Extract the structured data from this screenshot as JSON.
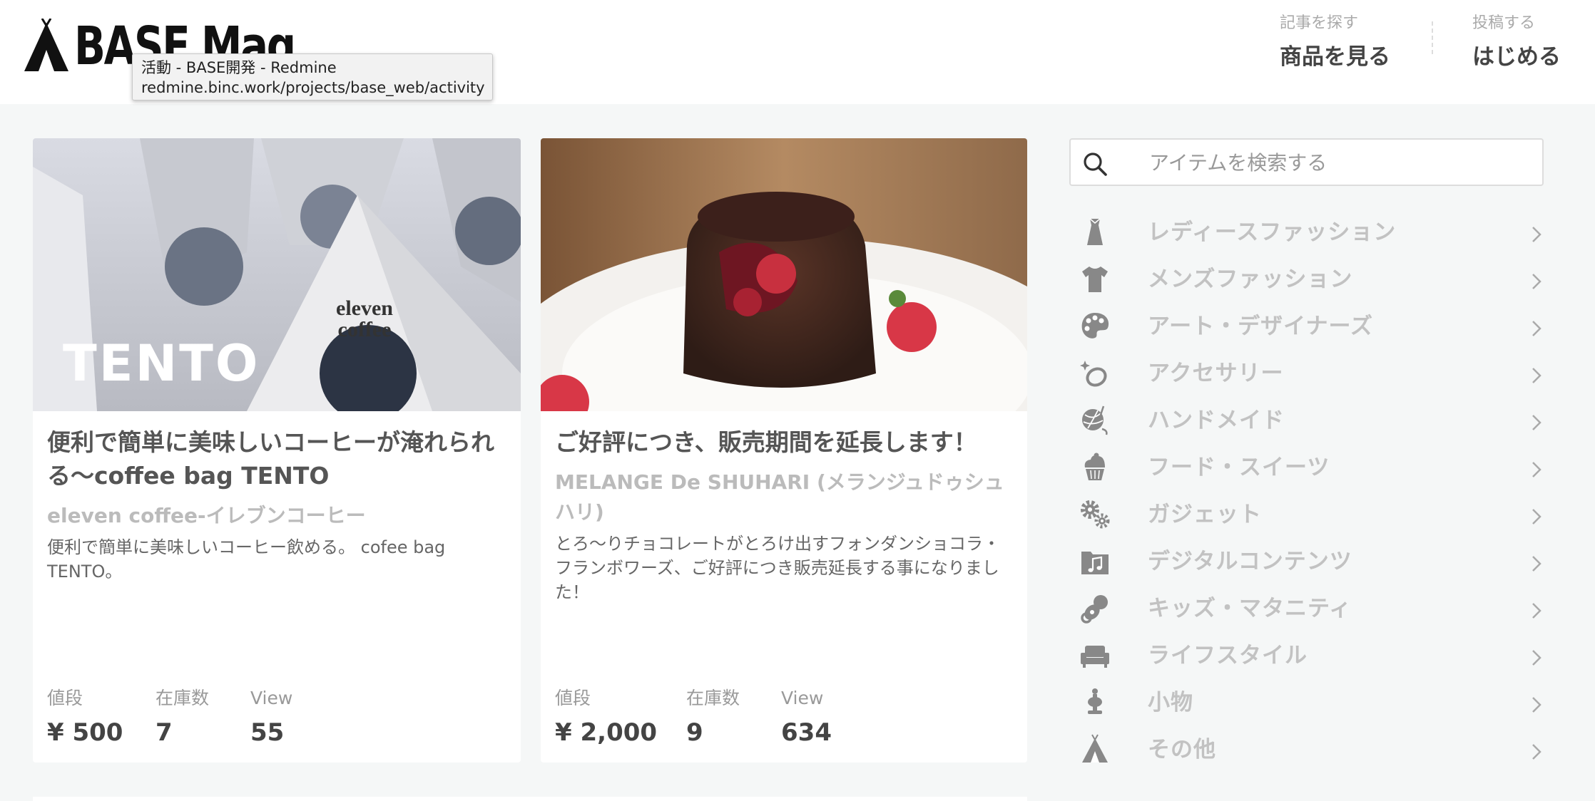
{
  "header": {
    "logo_text": "BASE Mag",
    "tooltip": {
      "title": "活動 - BASE開発 - Redmine",
      "url": "redmine.binc.work/projects/base_web/activity"
    },
    "nav": [
      {
        "small": "記事を探す",
        "big": "商品を見る"
      },
      {
        "small": "投稿する",
        "big": "はじめる"
      }
    ]
  },
  "cards": [
    {
      "image_text": "TENTO",
      "title": "便利で簡単に美味しいコーヒーが淹れられる〜coffee bag TENTO",
      "shop": "eleven coffee-イレブンコーヒー",
      "desc": "便利で簡単に美味しいコーヒー飲める。 cofee bag TENTO。",
      "stats": [
        {
          "label": "値段",
          "value": "¥ 500"
        },
        {
          "label": "在庫数",
          "value": "7"
        },
        {
          "label": "View",
          "value": "55"
        }
      ]
    },
    {
      "title": "ご好評につき、販売期間を延長します！",
      "shop": "MELANGE De SHUHARI (メランジュドゥシュハリ)",
      "desc": "とろ〜りチョコレートがとろけ出すフォンダンショコラ・フランボワーズ、ご好評につき販売延長する事になりました！",
      "stats": [
        {
          "label": "値段",
          "value": "¥ 2,000"
        },
        {
          "label": "在庫数",
          "value": "9"
        },
        {
          "label": "View",
          "value": "634"
        }
      ]
    }
  ],
  "search": {
    "placeholder": "アイテムを検索する"
  },
  "categories": [
    {
      "label": "レディースファッション",
      "icon": "dress-icon"
    },
    {
      "label": "メンズファッション",
      "icon": "tshirt-icon"
    },
    {
      "label": "アート・デザイナーズ",
      "icon": "palette-icon"
    },
    {
      "label": "アクセサリー",
      "icon": "ring-icon"
    },
    {
      "label": "ハンドメイド",
      "icon": "yarn-icon"
    },
    {
      "label": "フード・スイーツ",
      "icon": "cupcake-icon"
    },
    {
      "label": "ガジェット",
      "icon": "gears-icon"
    },
    {
      "label": "デジタルコンテンツ",
      "icon": "music-folder-icon"
    },
    {
      "label": "キッズ・マタニティ",
      "icon": "pacifier-icon"
    },
    {
      "label": "ライフスタイル",
      "icon": "sofa-icon"
    },
    {
      "label": "小物",
      "icon": "figurine-icon"
    },
    {
      "label": "その他",
      "icon": "tent-icon"
    }
  ]
}
